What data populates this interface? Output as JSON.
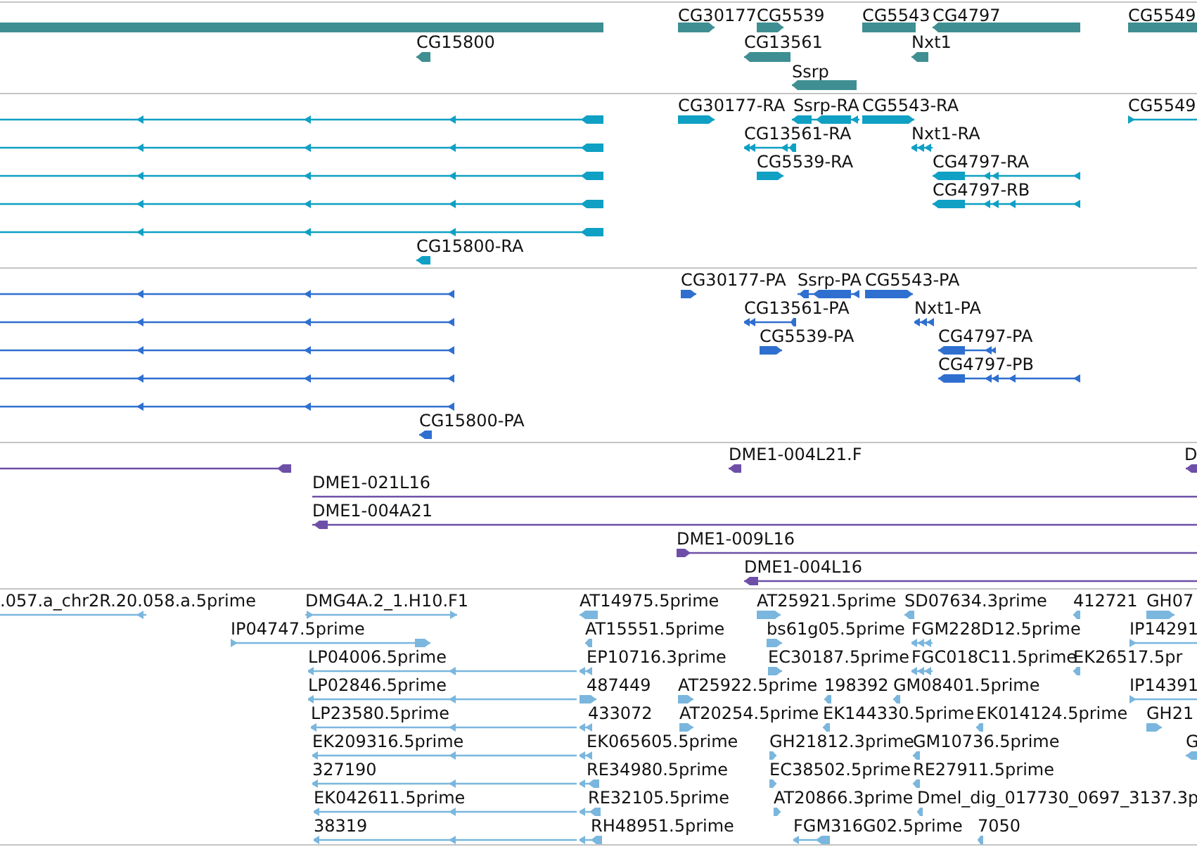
{
  "tracks": [
    {
      "kind": "gene",
      "features": [
        {
          "label": "CG30177"
        },
        {
          "label": "CG5539"
        },
        {
          "label": "CG5543"
        },
        {
          "label": "CG4797"
        },
        {
          "label": "CG5549"
        },
        {
          "label": "CG15800"
        },
        {
          "label": "CG13561"
        },
        {
          "label": "Nxt1"
        },
        {
          "label": "Ssrp"
        }
      ]
    },
    {
      "kind": "transcript",
      "features": [
        {
          "label": "CG30177-RA"
        },
        {
          "label": "Ssrp-RA"
        },
        {
          "label": "CG5543-RA"
        },
        {
          "label": "CG5549"
        },
        {
          "label": "CG13561-RA"
        },
        {
          "label": "Nxt1-RA"
        },
        {
          "label": "CG5539-RA"
        },
        {
          "label": "CG4797-RA"
        },
        {
          "label": "CG4797-RB"
        },
        {
          "label": "CG15800-RA"
        }
      ]
    },
    {
      "kind": "cds",
      "features": [
        {
          "label": "CG30177-PA"
        },
        {
          "label": "Ssrp-PA"
        },
        {
          "label": "CG5543-PA"
        },
        {
          "label": "CG13561-PA"
        },
        {
          "label": "Nxt1-PA"
        },
        {
          "label": "CG5539-PA"
        },
        {
          "label": "CG4797-PA"
        },
        {
          "label": "CG4797-PB"
        },
        {
          "label": "CG15800-PA"
        }
      ]
    },
    {
      "kind": "clone",
      "features": [
        {
          "label": "DME1-004L21.F"
        },
        {
          "label": "D"
        },
        {
          "label": "DME1-021L16"
        },
        {
          "label": "DME1-004A21"
        },
        {
          "label": "DME1-009L16"
        },
        {
          "label": "DME1-004L16"
        }
      ]
    },
    {
      "kind": "est",
      "features": [
        {
          "label": ".057.a_chr2R.20.058.a.5prime"
        },
        {
          "label": "DMG4A.2_1.H10.F1"
        },
        {
          "label": "AT14975.5prime"
        },
        {
          "label": "AT25921.5prime"
        },
        {
          "label": "SD07634.3prime"
        },
        {
          "label": "412721"
        },
        {
          "label": "GH07"
        },
        {
          "label": "IP04747.5prime"
        },
        {
          "label": "AT15551.5prime"
        },
        {
          "label": "bs61g05.5prime"
        },
        {
          "label": "FGM228D12.5prime"
        },
        {
          "label": "IP14291"
        },
        {
          "label": "LP04006.5prime"
        },
        {
          "label": "EP10716.3prime"
        },
        {
          "label": "EC30187.5prime"
        },
        {
          "label": "FGC018C11.5prime"
        },
        {
          "label": "EK26517.5pr"
        },
        {
          "label": "LP02846.5prime"
        },
        {
          "label": "487449"
        },
        {
          "label": "AT25922.5prime"
        },
        {
          "label": "198392"
        },
        {
          "label": "GM08401.5prime"
        },
        {
          "label": "IP14391"
        },
        {
          "label": "LP23580.5prime"
        },
        {
          "label": "433072"
        },
        {
          "label": "AT20254.5prime"
        },
        {
          "label": "EK144330.5prime"
        },
        {
          "label": "EK014124.5prime"
        },
        {
          "label": "GH21"
        },
        {
          "label": "EK209316.5prime"
        },
        {
          "label": "EK065605.5prime"
        },
        {
          "label": "GH21812.3prime"
        },
        {
          "label": "GM10736.5prime"
        },
        {
          "label": "G"
        },
        {
          "label": "327190"
        },
        {
          "label": "RE34980.5prime"
        },
        {
          "label": "EC38502.5prime"
        },
        {
          "label": "RE27911.5prime"
        },
        {
          "label": "EK042611.5prime"
        },
        {
          "label": "RE32105.5prime"
        },
        {
          "label": "AT20866.3prime"
        },
        {
          "label": "Dmel_dig_017730_0697_3137.3p"
        },
        {
          "label": "38319"
        },
        {
          "label": "RH48951.5prime"
        },
        {
          "label": "FGM316G02.5prime"
        },
        {
          "label": "7050"
        }
      ]
    }
  ]
}
